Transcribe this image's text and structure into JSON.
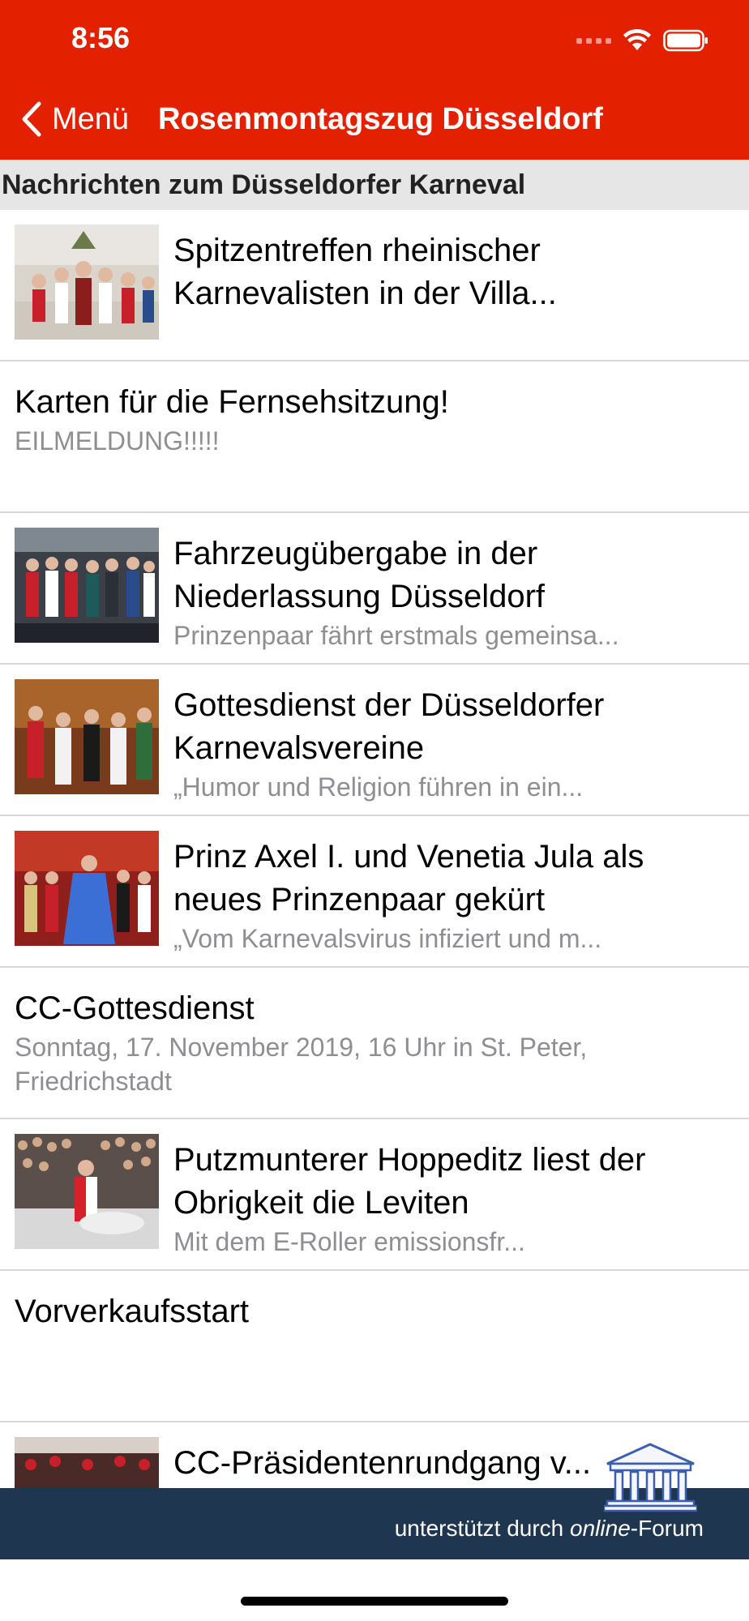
{
  "status_bar": {
    "time": "8:56"
  },
  "nav": {
    "back_label": "Menü",
    "title": "Rosenmontagszug Düsseldorf"
  },
  "section": {
    "title": "Nachrichten zum Düsseldorfer Karneval"
  },
  "news": [
    {
      "title": "Spitzentreffen rheinischer Karnevalisten in der Villa...",
      "subtitle": "",
      "has_image": true,
      "thumb_icon": "carnival-group-photo"
    },
    {
      "title": "Karten für die Fernsehsitzung!",
      "subtitle": "EILMELDUNG!!!!!",
      "has_image": false
    },
    {
      "title": "Fahrzeugübergabe in der Niederlassung Düsseldorf",
      "subtitle": "Prinzenpaar fährt erstmals gemeinsa...",
      "has_image": true,
      "thumb_icon": "vehicle-handover-photo"
    },
    {
      "title": "Gottesdienst der Düsseldorfer Karnevalsvereine",
      "subtitle": "„Humor und Religion führen in ein...",
      "has_image": true,
      "thumb_icon": "church-service-photo"
    },
    {
      "title": "Prinz Axel I. und Venetia Jula als neues Prinzenpaar gekürt",
      "subtitle": "„Vom Karnevalsvirus infiziert und m...",
      "has_image": true,
      "thumb_icon": "prince-couple-photo"
    },
    {
      "title": "CC-Gottesdienst",
      "subtitle": "Sonntag, 17. November 2019,  16 Uhr in St. Peter, Friedrichstadt",
      "has_image": false
    },
    {
      "title": "Putzmunterer Hoppeditz liest der Obrigkeit die Leviten",
      "subtitle": "Mit dem E-Roller emissionsfr...",
      "has_image": true,
      "thumb_icon": "hoppeditz-crowd-photo"
    },
    {
      "title": "Vorverkaufsstart",
      "subtitle": "",
      "has_image": false
    },
    {
      "title": "CC-Präsidentenrundgang v...",
      "subtitle": "",
      "has_image": true,
      "thumb_icon": "hall-audience-photo"
    }
  ],
  "footer": {
    "prefix": "unterstützt durch ",
    "brand_italic": "online",
    "brand_suffix": "-Forum"
  },
  "colors": {
    "accent": "#e32000",
    "footer_bg": "#1e3650",
    "section_bg": "#e6e6e6",
    "subtitle": "#8e8e93"
  }
}
